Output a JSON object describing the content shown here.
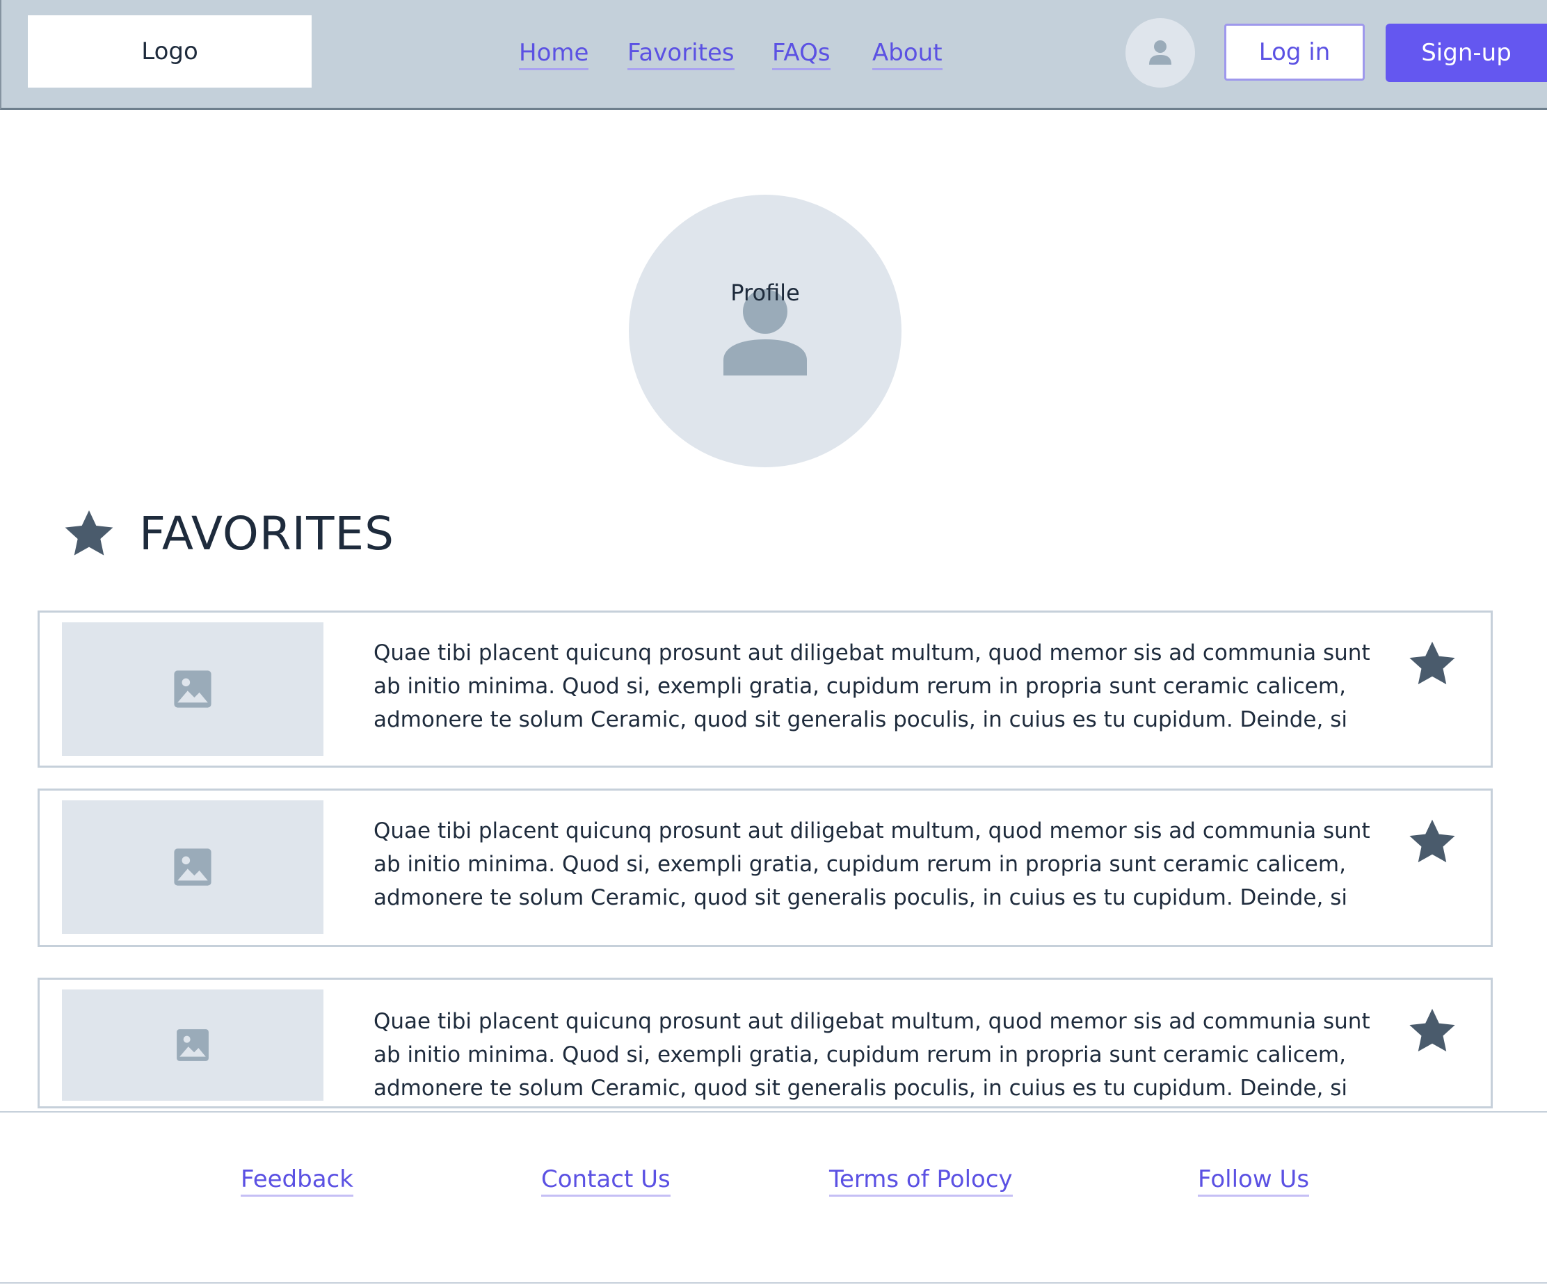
{
  "header": {
    "logo": "Logo",
    "nav": [
      "Home",
      "Favorites",
      "FAQs",
      "About"
    ],
    "login_label": "Log in",
    "signup_label": "Sign-up",
    "avatar_icon": "user-icon"
  },
  "profile": {
    "label": "Profile",
    "icon": "user-icon"
  },
  "favorites": {
    "title": "FAVORITES",
    "icon": "star-icon",
    "items": [
      {
        "thumb_icon": "image-icon",
        "text": "Quae tibi placent quicunq prosunt aut diligebat multum, quod memor sis ad communia sunt ab initio minima. Quod si, exempli gratia, cupidum rerum in propria sunt ceramic calicem, admonere te solum Ceramic, quod sit generalis poculis, in cuius es tu cupidum. Deinde, si",
        "star_icon": "star-icon"
      },
      {
        "thumb_icon": "image-icon",
        "text": "Quae tibi placent quicunq prosunt aut diligebat multum, quod memor sis ad communia sunt ab initio minima. Quod si, exempli gratia, cupidum rerum in propria sunt ceramic calicem, admonere te solum Ceramic, quod sit generalis poculis, in cuius es tu cupidum. Deinde, si",
        "star_icon": "star-icon"
      },
      {
        "thumb_icon": "image-icon",
        "text": "Quae tibi placent quicunq prosunt aut diligebat multum, quod memor sis ad communia sunt ab initio minima. Quod si, exempli gratia, cupidum rerum in propria sunt ceramic calicem, admonere te solum Ceramic, quod sit generalis poculis, in cuius es tu cupidum. Deinde, si",
        "star_icon": "star-icon"
      }
    ]
  },
  "footer": {
    "links": [
      "Feedback",
      "Contact Us",
      "Terms of Polocy",
      "Follow Us"
    ]
  },
  "colors": {
    "header_bg": "#c4d0da",
    "accent": "#6457f0",
    "link": "#5b51e3",
    "placeholder_bg": "#dfe5ec",
    "icon_gray": "#9aabb9",
    "star": "#4a5b6c",
    "text": "#1e2b3c"
  }
}
